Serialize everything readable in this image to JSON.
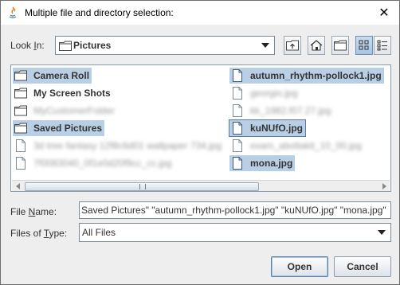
{
  "window": {
    "title": "Multiple file and directory selection:",
    "close_glyph": "✕"
  },
  "lookin": {
    "label_pre": "Look ",
    "label_mnemonic": "I",
    "label_post": "n:",
    "value": "Pictures",
    "arrow_glyph": "▼"
  },
  "toolbar": {
    "icons": [
      "up-one-level-icon",
      "home-icon",
      "new-folder-icon",
      "list-view-icon",
      "details-view-icon"
    ]
  },
  "files": {
    "col1": [
      {
        "name": "Camera Roll",
        "type": "folder",
        "selected": true,
        "blurred": false
      },
      {
        "name": "My Screen Shots",
        "type": "folder",
        "selected": false,
        "blurred": false
      },
      {
        "name": "MyCustomerFolder",
        "type": "folder",
        "selected": false,
        "blurred": true
      },
      {
        "name": "Saved Pictures",
        "type": "folder",
        "selected": true,
        "blurred": false
      },
      {
        "name": "3d tree fantasy 12f8c6d01 wallpaper 734.jpg",
        "type": "file",
        "selected": false,
        "blurred": true
      },
      {
        "name": "7f0083040_0f1e0d20f9cc_cc.jpg",
        "type": "file",
        "selected": false,
        "blurred": true
      }
    ],
    "col2": [
      {
        "name": "autumn_rhythm-pollock1.jpg",
        "type": "file",
        "selected": true,
        "blurred": false,
        "focus": false
      },
      {
        "name": "georgio.jpg",
        "type": "file",
        "selected": false,
        "blurred": true,
        "focus": false
      },
      {
        "name": "kk_1982.f07.27.jpg",
        "type": "file",
        "selected": false,
        "blurred": true,
        "focus": false
      },
      {
        "name": "kuNUfO.jpg",
        "type": "file",
        "selected": true,
        "blurred": false,
        "focus": true
      },
      {
        "name": "exam_aboltakit_10_00.jpg",
        "type": "file",
        "selected": false,
        "blurred": true,
        "focus": false
      },
      {
        "name": "mona.jpg",
        "type": "file",
        "selected": true,
        "blurred": false,
        "focus": false
      }
    ]
  },
  "filename": {
    "label_pre": "File ",
    "label_mnemonic": "N",
    "label_post": "ame:",
    "value": "Saved Pictures\" \"autumn_rhythm-pollock1.jpg\" \"kuNUfO.jpg\" \"mona.jpg\""
  },
  "filetype": {
    "label_pre": "Files of ",
    "label_mnemonic": "T",
    "label_post": "ype:",
    "value": "All Files",
    "arrow_glyph": "▼"
  },
  "buttons": {
    "open": "Open",
    "cancel": "Cancel"
  },
  "colors": {
    "selection": "#b8cfe5",
    "window_bg": "#eeeeee",
    "border": "#7a8a99"
  }
}
